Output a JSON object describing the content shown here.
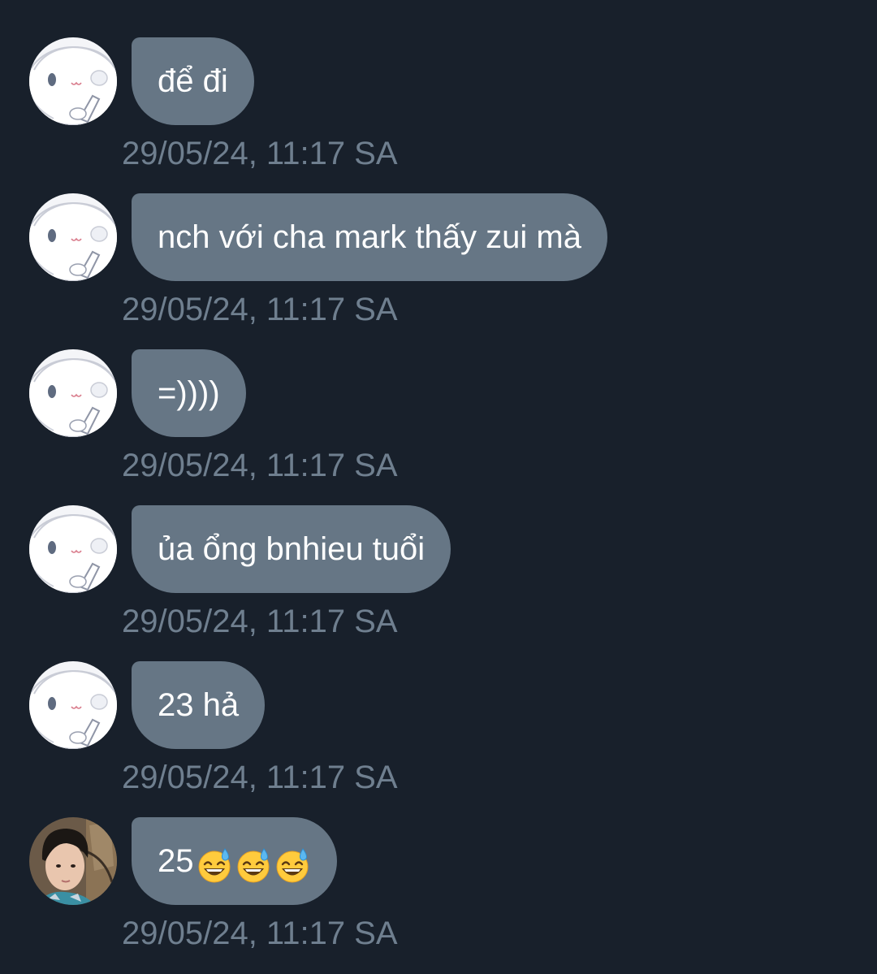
{
  "colors": {
    "background": "#18202b",
    "bubble": "#667685",
    "message_text": "#ffffff",
    "timestamp_text": "#6f7f8f"
  },
  "messages": [
    {
      "text": "để đi",
      "timestamp": "29/05/24, 11:17 SA",
      "avatar": "cartoon-avatar-icon"
    },
    {
      "text": "nch với cha mark thấy zui mà",
      "timestamp": "29/05/24, 11:17 SA",
      "avatar": "cartoon-avatar-icon"
    },
    {
      "text": "=))))",
      "timestamp": "29/05/24, 11:17 SA",
      "avatar": "cartoon-avatar-icon"
    },
    {
      "text": "ủa ổng bnhieu tuổi",
      "timestamp": "29/05/24, 11:17 SA",
      "avatar": "cartoon-avatar-icon"
    },
    {
      "text": "23 hả",
      "timestamp": "29/05/24, 11:17 SA",
      "avatar": "cartoon-avatar-icon"
    },
    {
      "text": "25",
      "emojis": [
        "grinning-sweat-emoji",
        "grinning-sweat-emoji",
        "grinning-sweat-emoji"
      ],
      "timestamp": "29/05/24, 11:17 SA",
      "avatar": "person-photo-avatar"
    }
  ]
}
